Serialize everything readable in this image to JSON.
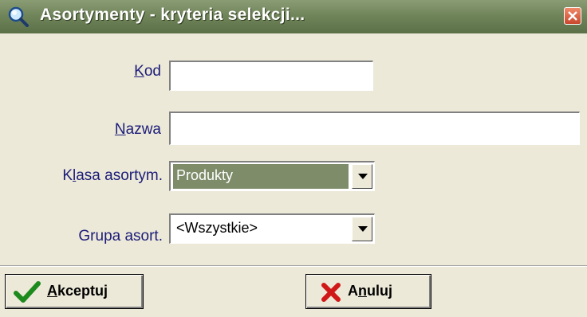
{
  "window": {
    "title": "Asortymenty - kryteria selekcji...",
    "title_icon": "magnifier-icon",
    "close_icon": "close-icon"
  },
  "form": {
    "kod": {
      "label": "Kod",
      "value": ""
    },
    "nazwa": {
      "label": "Nazwa",
      "value": ""
    },
    "klasa": {
      "label": "Klasa asortym.",
      "value": "Produkty"
    },
    "grupa": {
      "label": "Grupa asort.",
      "value": "<Wszystkie>"
    }
  },
  "buttons": {
    "accept": {
      "label": "Akceptuj",
      "icon": "checkmark-icon"
    },
    "cancel": {
      "label": "Anuluj",
      "icon": "x-cross-icon"
    }
  },
  "colors": {
    "titlebar": "#71855b",
    "label_text": "#1c1c7a",
    "selection": "#7e8c6a",
    "background": "#ece9d8"
  }
}
